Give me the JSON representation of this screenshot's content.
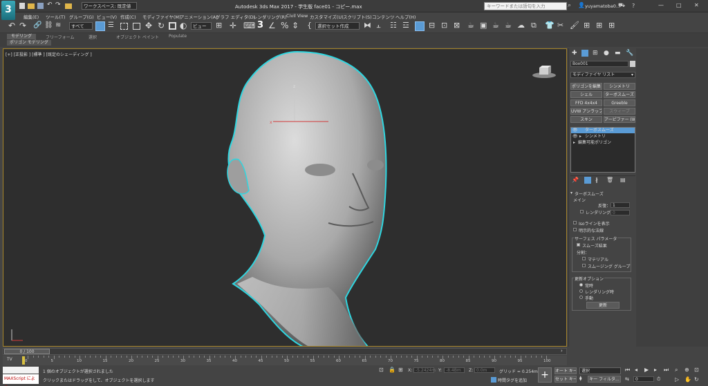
{
  "app": {
    "title": "Autodesk 3ds Max 2017 - 学生版   face01 - コピー.max",
    "logo_text": "3"
  },
  "titlebar": {
    "workspace_label": "ワークスペース: 既定値",
    "search_placeholder": "キーワードまたは語句を入力",
    "user": "yuyamatoba0...",
    "win_min": "—",
    "win_max": "□",
    "win_close": "✕"
  },
  "menu": [
    "編集(E)",
    "ツール(T)",
    "グループ(G)",
    "ビュー(V)",
    "作成(C)",
    "モディファイヤ(M)",
    "アニメーション(A)",
    "グラフ エディタ(D)",
    "レンダリング(R)",
    "Civil View",
    "カスタマイズ(U)",
    "スクリプト(S)",
    "コンテンツ",
    "ヘルプ(H)"
  ],
  "toolbar": {
    "filter_value": "すべて",
    "view_value": "ビュー",
    "selection_set_value": "選択セット作成"
  },
  "ribbon": {
    "tabs": [
      "モデリング",
      "フリーフォーム",
      "選択",
      "オブジェクト ペイント",
      "Populate"
    ],
    "subtab": "ポリゴン モデリング"
  },
  "viewport": {
    "label": "[+] [正投影 ] [標準 ] [既定のシェーディング ]",
    "axis_x": "x",
    "axis_z": "z"
  },
  "command_panel": {
    "object_name": "Box001",
    "modifier_list": "モディファイヤ リスト",
    "mod_buttons": [
      "ポリゴンを編集",
      "シンメトリ",
      "シェル",
      "ターボスムーズ",
      "FFD 4x4x4",
      "Greeble",
      "UVW アンラップ",
      "スウィープ",
      "スキン",
      "アーピファー (WSM)"
    ],
    "stack": [
      "ターボスムーズ",
      "シンメトリ",
      "編集可能ポリゴン"
    ]
  },
  "turbosmooth": {
    "rollout_title": "ターボスムーズ",
    "main_label": "メイン",
    "iterations_label": "反復：",
    "iterations_value": "1",
    "render_iter_label": "レンダリング反復：",
    "render_iter_value": "0",
    "isoline_label": "Isoラインを表示",
    "explicit_normals_label": "明示的な法線",
    "surface_group": "サーフェス パラメータ",
    "smooth_result_label": "スムーズ結果",
    "separate_label": "分割：",
    "material_label": "マテリアル",
    "smoothing_group_label": "スムージング グループ",
    "update_group": "更新オプション",
    "always_label": "常時",
    "when_render_label": "レンダリング時",
    "manual_label": "手動",
    "update_button": "更新"
  },
  "timeline": {
    "slider_text": "0 / 100",
    "ticks": [
      "0",
      "5",
      "10",
      "15",
      "20",
      "25",
      "30",
      "35",
      "40",
      "45",
      "50",
      "55",
      "60",
      "65",
      "70",
      "75",
      "80",
      "85",
      "90",
      "95",
      "100"
    ]
  },
  "status": {
    "maxscript_label": "MAXScript によう",
    "selected_text": "1 個のオブジェクトが選択されました",
    "prompt_text": "クリックまたはドラッグをして、オブジェクトを選択します",
    "x_label": "X:",
    "x_value": "-5.2424m",
    "y_label": "Y:",
    "y_value": "-8.4Bm",
    "z_label": "Z:",
    "z_value": "0.0m",
    "grid_label": "グリッド = 0.254m",
    "add_time_tag": "時間タグを追加",
    "auto_key": "オート キー",
    "set_key": "セット キー",
    "selected_dropdown": "選択",
    "key_filter": "キー フィルタ...",
    "frame_value": "0"
  },
  "colors": {
    "selection_outline": "#2fd6e0",
    "accent": "#5a9bd5",
    "viewport_bg": "#2e2e2e"
  }
}
